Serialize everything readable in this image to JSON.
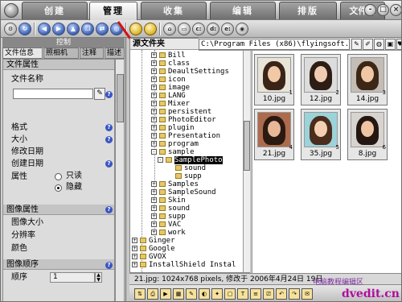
{
  "tabs": [
    "创建",
    "管理",
    "收集",
    "编辑",
    "排版",
    "文件转"
  ],
  "active_tab": 1,
  "window_buttons": {
    "minimize": "-",
    "maximize": "□",
    "close": "×"
  },
  "left_panel": {
    "caption": "控制",
    "tabs": [
      "文件信息",
      "照相机",
      "注释",
      "描述"
    ],
    "file_attrs": {
      "heading": "文件属性",
      "name_label": "文件名称",
      "format_label": "格式",
      "size_label": "大小",
      "modified_label": "修改日期",
      "created_label": "创建日期",
      "attr_label": "属性",
      "readonly_label": "只读",
      "hidden_label": "隐藏"
    },
    "image_attrs": {
      "heading": "图像属性",
      "image_size_label": "图像大小",
      "resolution_label": "分辨率",
      "color_label": "颜色"
    },
    "image_order": {
      "heading": "图像顺序",
      "order_label": "顺序",
      "order_value": "1"
    }
  },
  "folder_panel": {
    "title": "源文件夹",
    "path": "C:\\Program Files (x86)\\flyingsoft.com",
    "tree": [
      {
        "label": "Bill",
        "expander": "+"
      },
      {
        "label": "class",
        "expander": "+"
      },
      {
        "label": "DeaultSettings",
        "expander": "+"
      },
      {
        "label": "icon",
        "expander": "+"
      },
      {
        "label": "image",
        "expander": "+"
      },
      {
        "label": "LANG",
        "expander": "+"
      },
      {
        "label": "Mixer",
        "expander": "+"
      },
      {
        "label": "persistent",
        "expander": "+"
      },
      {
        "label": "PhotoEditor",
        "expander": "+"
      },
      {
        "label": "plugin",
        "expander": "+"
      },
      {
        "label": "Presentation",
        "expander": "+"
      },
      {
        "label": "program",
        "expander": "+"
      },
      {
        "label": "sample",
        "expander": "-"
      },
      {
        "label": "SamplePhoto",
        "expander": "-"
      },
      {
        "label": "sound",
        "expander": ""
      },
      {
        "label": "supp",
        "expander": ""
      },
      {
        "label": "Samples",
        "expander": "+"
      },
      {
        "label": "SampleSound",
        "expander": "+"
      },
      {
        "label": "Skin",
        "expander": "+"
      },
      {
        "label": "sound",
        "expander": "+"
      },
      {
        "label": "supp",
        "expander": "+"
      },
      {
        "label": "VAC",
        "expander": "+"
      },
      {
        "label": "work",
        "expander": "+"
      },
      {
        "label": "Ginger",
        "expander": "+"
      },
      {
        "label": "Google",
        "expander": "+"
      },
      {
        "label": "GVOX",
        "expander": "+"
      },
      {
        "label": "InstallShield Instal",
        "expander": "+"
      }
    ],
    "selected": "SamplePhoto"
  },
  "thumbnails": [
    {
      "name": "10.jpg",
      "num": "1"
    },
    {
      "name": "12.jpg",
      "num": "2"
    },
    {
      "name": "14.jpg",
      "num": "3"
    },
    {
      "name": "21.jpg",
      "num": "4"
    },
    {
      "name": "35.jpg",
      "num": "5"
    },
    {
      "name": "8.jpg",
      "num": "6"
    }
  ],
  "status_text": "21.jpg: 1024x768 pixels, 修改于 2006年4月24日 19日",
  "watermark": {
    "top": "电脑教程编辑区",
    "main": "dvedit.cn"
  },
  "colors": {
    "selection": "#000000",
    "watermark": "#b00c9c",
    "info_badge": "#3a55c4"
  }
}
